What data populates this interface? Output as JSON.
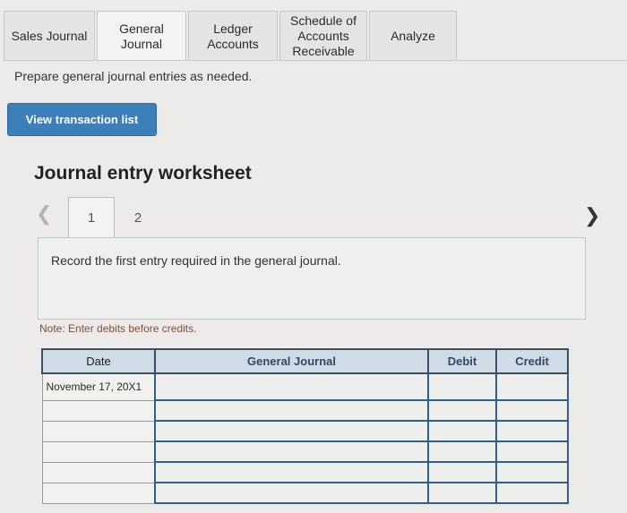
{
  "tabs": [
    {
      "label": "Sales Journal"
    },
    {
      "label": "General\nJournal"
    },
    {
      "label": "Ledger\nAccounts"
    },
    {
      "label": "Schedule of\nAccounts\nReceivable"
    },
    {
      "label": "Analyze"
    }
  ],
  "instruction": "Prepare general journal entries as needed.",
  "view_button_label": "View transaction list",
  "worksheet_title": "Journal entry worksheet",
  "pager": {
    "pages": [
      "1",
      "2"
    ],
    "current": "1"
  },
  "record_text": "Record the first entry required in the general journal.",
  "note": "Note: Enter debits before credits.",
  "table": {
    "headers": {
      "date": "Date",
      "general_journal": "General Journal",
      "debit": "Debit",
      "credit": "Credit"
    },
    "rows": [
      {
        "date": "November 17, 20X1"
      },
      {
        "date": ""
      },
      {
        "date": ""
      },
      {
        "date": ""
      },
      {
        "date": ""
      },
      {
        "date": ""
      }
    ]
  }
}
